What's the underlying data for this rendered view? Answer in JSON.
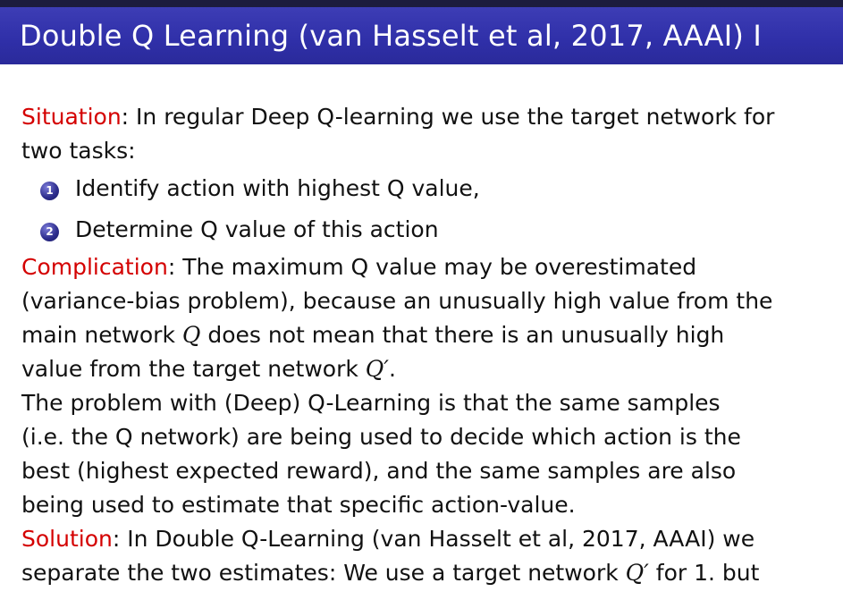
{
  "slide": {
    "title": "Double Q Learning (van Hasselt et al, 2017, AAAI) I"
  },
  "situation": {
    "label": "Situation",
    "text_1": ": In regular Deep Q-learning we use the target network for",
    "text_2": "two tasks:"
  },
  "list": [
    {
      "number": "1",
      "text": "Identify action with highest Q value,"
    },
    {
      "number": "2",
      "text": "Determine Q value of this action"
    }
  ],
  "complication": {
    "label": "Complication",
    "line_1": ": The maximum Q value may be overestimated",
    "line_2": "(variance-bias problem), because an unusually high value from the",
    "line_3_a": "main network ",
    "line_3_b": " does not mean that there is an unusually high",
    "line_4_a": "value from the target network ",
    "line_4_b": "."
  },
  "problem": {
    "line_1": "The problem with (Deep) Q-Learning is that the same samples",
    "line_2": "(i.e. the Q network) are being used to decide which action is the",
    "line_3": "best (highest expected reward), and the same samples are also",
    "line_4": "being used to estimate that specific action-value."
  },
  "solution": {
    "label": "Solution",
    "line_1": ": In Double Q-Learning (van Hasselt et al, 2017, AAAI) we",
    "line_2_a": "separate the two estimates: We use a target network ",
    "line_2_b": " for 1. but"
  },
  "symbols": {
    "q": "Q",
    "q_prime": "Q′"
  },
  "colors": {
    "title_bar": "#2f2fa8",
    "title_text": "#ffffff",
    "highlight": "#d40000",
    "bullet": "#2b2b8a"
  }
}
